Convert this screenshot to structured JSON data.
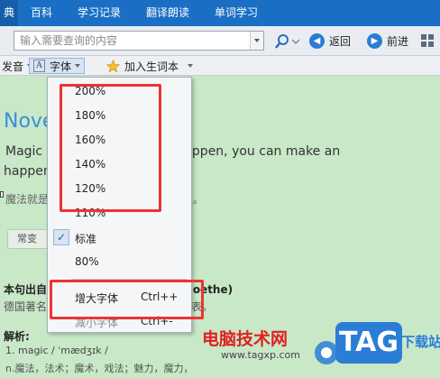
{
  "topnav": {
    "cut_label": "典",
    "tabs": [
      "百科",
      "学习记录",
      "翻译朗读",
      "单词学习"
    ]
  },
  "search": {
    "placeholder": "输入需要查询的内容",
    "back_label": "返回",
    "forward_label": "前进"
  },
  "toolbar": {
    "pronounce_label": "发音",
    "font_label": "字体",
    "add_wordbook_label": "加入生词本"
  },
  "content": {
    "heading_word": "Nove",
    "example_en_line1": "Magic i                             you can make that happen, you can make an",
    "example_en_line2": "happen",
    "example_cn": "魔法就是                              一点，你就能让任何事情发生。",
    "chip_label": "常变",
    "source_heading": "本句出自                            Johann Wolfgang von Goethe)",
    "source_text": "德国著名                             是魏玛的古典主义最著名的代表。",
    "analysis_heading": "解析:",
    "analysis_line1": "1. magic / ˈmædʒɪk /",
    "analysis_line2": "n.魔法，法术；魔术，戏法；魅力，魔力，"
  },
  "font_menu": {
    "items": [
      {
        "label": "200%"
      },
      {
        "label": "180%"
      },
      {
        "label": "160%"
      },
      {
        "label": "140%"
      },
      {
        "label": "120%"
      },
      {
        "label": "110%"
      },
      {
        "label": "标准",
        "checked": true
      },
      {
        "label": "80%"
      }
    ],
    "checkmark": "✓",
    "enlarge_label": "增大字体",
    "enlarge_shortcut": "Ctrl++",
    "shrink_label": "减小字体",
    "shrink_shortcut": "Ctrl+-"
  },
  "watermark": {
    "site_cn": "电脑技术网",
    "url": "www.tagxp.com",
    "logo_text": "TAG",
    "logo_sub": "下载站"
  },
  "colors": {
    "nav_blue": "#1a6fc4",
    "content_bg": "#c8e8c8",
    "highlight_red": "#e33333",
    "heading_blue": "#3a8fd6"
  },
  "icons": {
    "search": "magnifier-icon",
    "back": "arrow-left-circle-icon",
    "forward": "arrow-right-circle-icon",
    "font": "font-a-icon",
    "star": "star-icon",
    "check": "check-icon"
  }
}
